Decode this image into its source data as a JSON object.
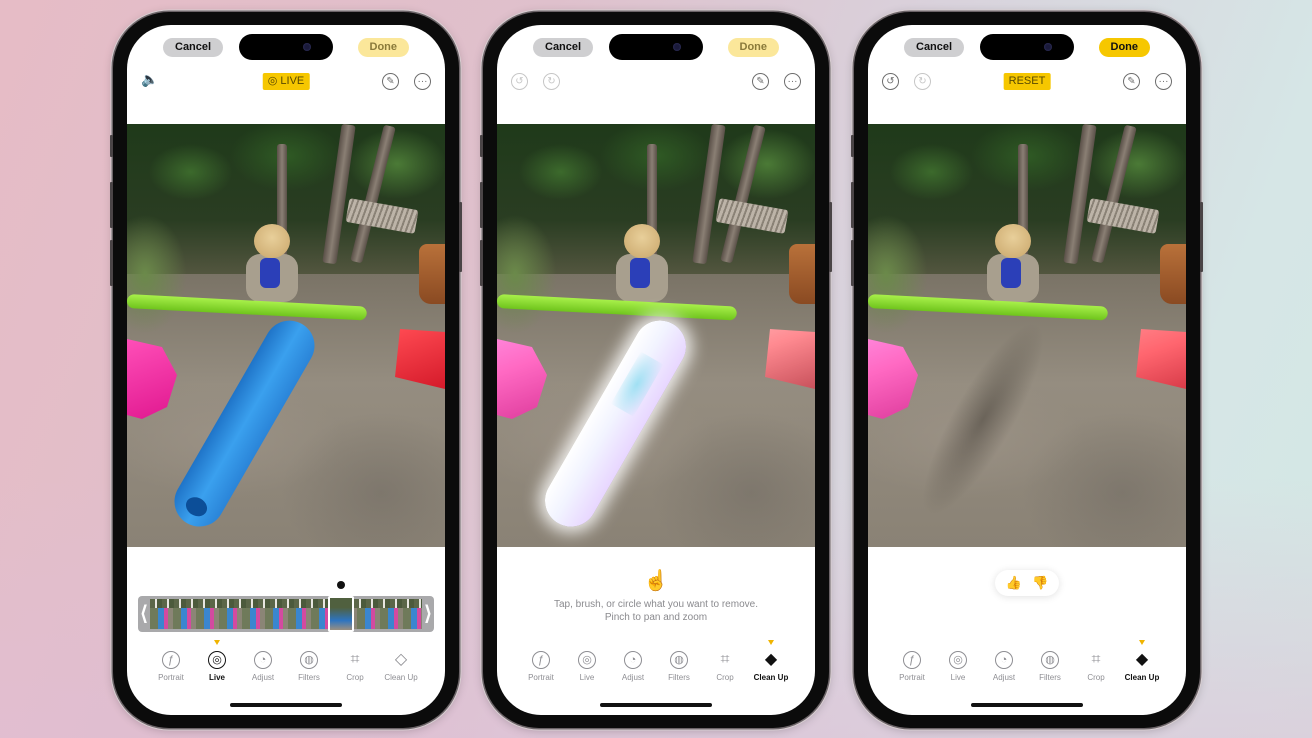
{
  "colors": {
    "accent_yellow": "#f6c700",
    "done_disabled": "#fbe79a",
    "cancel_gray": "#cfcfd1",
    "label_gray": "#8e8e93",
    "active_black": "#111111"
  },
  "phones": [
    {
      "cancel_label": "Cancel",
      "done_label": "Done",
      "done_enabled": false,
      "left_icons": [
        "speaker-icon"
      ],
      "center_badge": "◎ LIVE",
      "right_icons": [
        "markup-icon",
        "more-icon"
      ],
      "filmstrip": {
        "selected_frame": "key-photo"
      },
      "modes": [
        {
          "label": "Portrait",
          "icon": "ƒ"
        },
        {
          "label": "Live",
          "icon": "◎"
        },
        {
          "label": "Adjust",
          "icon": "◔"
        },
        {
          "label": "Filters",
          "icon": "◍"
        },
        {
          "label": "Crop",
          "icon": "⌗"
        },
        {
          "label": "Clean Up",
          "icon": "◇"
        }
      ],
      "active_mode": "Live"
    },
    {
      "cancel_label": "Cancel",
      "done_label": "Done",
      "done_enabled": false,
      "left_icons": [
        "undo-icon",
        "redo-icon"
      ],
      "right_icons": [
        "markup-icon",
        "more-icon"
      ],
      "hint_icon": "☝",
      "hint_line1": "Tap, brush, or circle what you want to remove.",
      "hint_line2": "Pinch to pan and zoom",
      "modes": [
        {
          "label": "Portrait",
          "icon": "ƒ"
        },
        {
          "label": "Live",
          "icon": "◎"
        },
        {
          "label": "Adjust",
          "icon": "◔"
        },
        {
          "label": "Filters",
          "icon": "◍"
        },
        {
          "label": "Crop",
          "icon": "⌗"
        },
        {
          "label": "Clean Up",
          "icon": "◆"
        }
      ],
      "active_mode": "Clean Up"
    },
    {
      "cancel_label": "Cancel",
      "done_label": "Done",
      "done_enabled": true,
      "left_icons": [
        "undo-icon",
        "redo-icon"
      ],
      "center_badge": "RESET",
      "right_icons": [
        "markup-icon",
        "more-icon"
      ],
      "feedback": {
        "thumbs_up": "👍",
        "thumbs_down": "👎"
      },
      "modes": [
        {
          "label": "Portrait",
          "icon": "ƒ"
        },
        {
          "label": "Live",
          "icon": "◎"
        },
        {
          "label": "Adjust",
          "icon": "◔"
        },
        {
          "label": "Filters",
          "icon": "◍"
        },
        {
          "label": "Crop",
          "icon": "⌗"
        },
        {
          "label": "Clean Up",
          "icon": "◆"
        }
      ],
      "active_mode": "Clean Up"
    }
  ],
  "glyphs": {
    "speaker": "🔈",
    "undo": "↺",
    "redo": "↻",
    "markup": "✎",
    "more": "···",
    "chev_left": "⟨",
    "chev_right": "⟩"
  }
}
